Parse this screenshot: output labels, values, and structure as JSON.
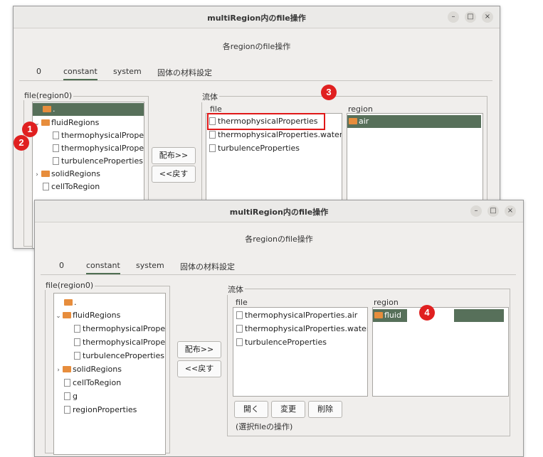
{
  "back": {
    "title": "multiRegion内のfile操作",
    "subtitle": "各regionのfile操作",
    "tabs": [
      "0",
      "constant",
      "system",
      "固体の材料設定"
    ],
    "tree_legend": "file(region0)",
    "tree": [
      {
        "label": ".",
        "type": "folder"
      },
      {
        "label": "fluidRegions",
        "type": "folder",
        "arrow": "⌄"
      },
      {
        "label": "thermophysicalPrope",
        "type": "file"
      },
      {
        "label": "thermophysicalPrope",
        "type": "file"
      },
      {
        "label": "turbulenceProperties",
        "type": "file"
      },
      {
        "label": "solidRegions",
        "type": "folder",
        "arrow": "›"
      },
      {
        "label": "cellToRegion",
        "type": "file"
      }
    ],
    "distribute_button": "配布>>",
    "return_button": "<<戻す",
    "group_legend": "流体",
    "file_header": "file",
    "region_header": "region",
    "files": [
      "thermophysicalProperties",
      "thermophysicalProperties.water",
      "turbulenceProperties"
    ],
    "regions": [
      "air"
    ]
  },
  "front": {
    "title": "multiRegion内のfile操作",
    "subtitle": "各regionのfile操作",
    "tabs": [
      "0",
      "constant",
      "system",
      "固体の材料設定"
    ],
    "tree_legend": "file(region0)",
    "tree": [
      {
        "label": ".",
        "type": "folder"
      },
      {
        "label": "fluidRegions",
        "type": "folder",
        "arrow": "⌄"
      },
      {
        "label": "thermophysicalPrope",
        "type": "file"
      },
      {
        "label": "thermophysicalPrope",
        "type": "file"
      },
      {
        "label": "turbulenceProperties",
        "type": "file"
      },
      {
        "label": "solidRegions",
        "type": "folder",
        "arrow": "›"
      },
      {
        "label": "cellToRegion",
        "type": "file"
      },
      {
        "label": "g",
        "type": "file"
      },
      {
        "label": "regionProperties",
        "type": "file"
      }
    ],
    "distribute_button": "配布>>",
    "return_button": "<<戻す",
    "group_legend": "流体",
    "file_header": "file",
    "region_header": "region",
    "files": [
      "thermophysicalProperties.air",
      "thermophysicalProperties.water",
      "turbulenceProperties"
    ],
    "regions": [
      "fluid"
    ],
    "open_button": "開く",
    "change_button": "変更",
    "delete_button": "削除",
    "ops_label": "(選択fileの操作)"
  },
  "window_controls": {
    "minimize": "–",
    "maximize": "□",
    "close": "×"
  },
  "callouts": [
    "1",
    "2",
    "3",
    "4"
  ],
  "colors": {
    "selection": "#57705a",
    "folder": "#e78d3c",
    "callout": "#e02020"
  }
}
